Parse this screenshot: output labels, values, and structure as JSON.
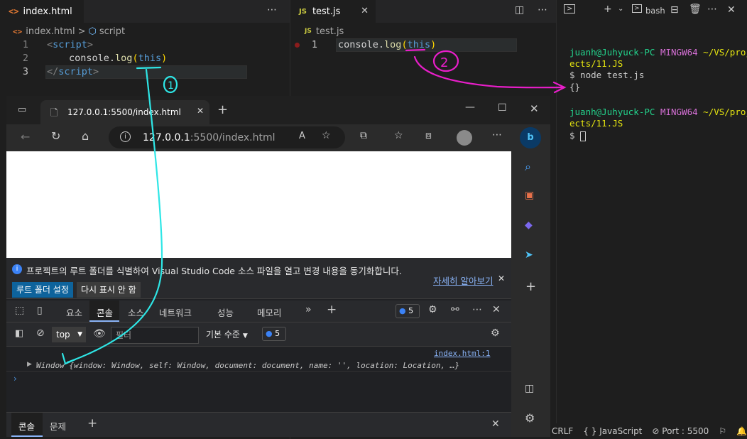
{
  "editor_left": {
    "tab_label": "index.html",
    "tab_icon": "<>",
    "breadcrumb_file": "index.html",
    "breadcrumb_sep": ">",
    "breadcrumb_symbol": "script",
    "lines": [
      {
        "num": "1",
        "open": "<",
        "tag": "script",
        "close": ">"
      },
      {
        "num": "2",
        "obj": "console",
        "dot": ".",
        "fn": "log",
        "p1": "(",
        "arg": "this",
        "p2": ")"
      },
      {
        "num": "3",
        "open": "</",
        "tag": "script",
        "close": ">"
      }
    ]
  },
  "editor_right": {
    "tab_label": "test.js",
    "tab_icon": "JS",
    "breadcrumb_file": "test.js",
    "line": {
      "num": "1",
      "obj": "console",
      "dot": ".",
      "fn": "log",
      "p1": "(",
      "arg": "this",
      "p2": ")"
    }
  },
  "terminal": {
    "shell_label": "bash",
    "lines": [
      {
        "user": "juanh@Juhyuck-PC",
        "env": "MINGW64",
        "path": "~/VS/proj"
      },
      {
        "cont": "ects/11.JS"
      },
      {
        "cmd": "$ node test.js"
      },
      {
        "out": "{}"
      },
      {
        "user": "juanh@Juhyuck-PC",
        "env": "MINGW64",
        "path": "~/VS/proj"
      },
      {
        "cont": "ects/11.JS"
      },
      {
        "cmd": "$ "
      }
    ]
  },
  "browser": {
    "tab_title": "127.0.0.1:5500/index.html",
    "url_host": "127.0.0.1",
    "url_rest": ":5500/index.html",
    "infobar_text": "프로젝트의 루트 폴더를 식별하여 Visual Studio Code 소스 파일을 열고 변경 내용을 동기화합니다.",
    "infobar_link": "자세히 알아보기",
    "btn_set_root": "루트 폴더 설정",
    "btn_dont_show": "다시 표시 안 함",
    "devtools_tabs": [
      "요소",
      "콘솔",
      "소스",
      "네트워크",
      "성능",
      "메모리"
    ],
    "issues_count": "5",
    "context": "top",
    "filter_placeholder": "필터",
    "level": "기본 수준",
    "level_count": "5",
    "console_source": "index.html:1",
    "console_output": "Window {window: Window, self: Window, document: document, name: '', location: Location, …}",
    "drawer_tabs": [
      "콘솔",
      "문제"
    ]
  },
  "statusbar": {
    "eol": "CRLF",
    "lang": "JavaScript",
    "port": "Port : 5500"
  },
  "annotations": {
    "label1": "1",
    "label2": "2",
    "color_cyan": "#2ee6e6",
    "color_magenta": "#e81ec9"
  }
}
